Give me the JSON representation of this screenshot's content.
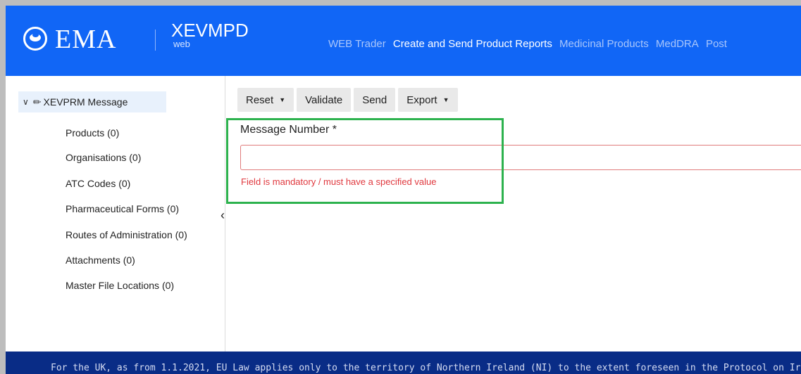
{
  "header": {
    "logo_text": "EMA",
    "app_name": "XEVMPD",
    "app_subtitle": "web",
    "nav": [
      "WEB Trader",
      "Create and Send Product Reports",
      "Medicinal Products",
      "MedDRA",
      "Post"
    ]
  },
  "sidebar": {
    "root_label": "XEVPRM Message",
    "items": [
      {
        "label": "Products (0)"
      },
      {
        "label": "Organisations (0)"
      },
      {
        "label": "ATC Codes (0)"
      },
      {
        "label": "Pharmaceutical Forms (0)"
      },
      {
        "label": "Routes of Administration (0)"
      },
      {
        "label": "Attachments (0)"
      },
      {
        "label": "Master File Locations (0)"
      }
    ]
  },
  "toolbar": {
    "reset_label": "Reset",
    "validate_label": "Validate",
    "send_label": "Send",
    "export_label": "Export"
  },
  "form": {
    "message_number_label": "Message Number *",
    "message_number_value": "",
    "message_number_error": "Field is mandatory / must have a specified value"
  },
  "footer": {
    "text": "For the UK, as from 1.1.2021, EU Law applies only to the territory of Northern Ireland (NI) to the extent foreseen in the Protocol on Ir"
  },
  "colors": {
    "header_bg": "#1166f6",
    "footer_bg": "#092c86",
    "highlight_box": "#2db24e",
    "error": "#e0383e",
    "selected_tree_bg": "#e8f1fc"
  },
  "icons": [
    "ema-logo-icon",
    "chevron-down-icon",
    "pencil-icon",
    "caret-down-icon",
    "chevron-left-icon"
  ]
}
